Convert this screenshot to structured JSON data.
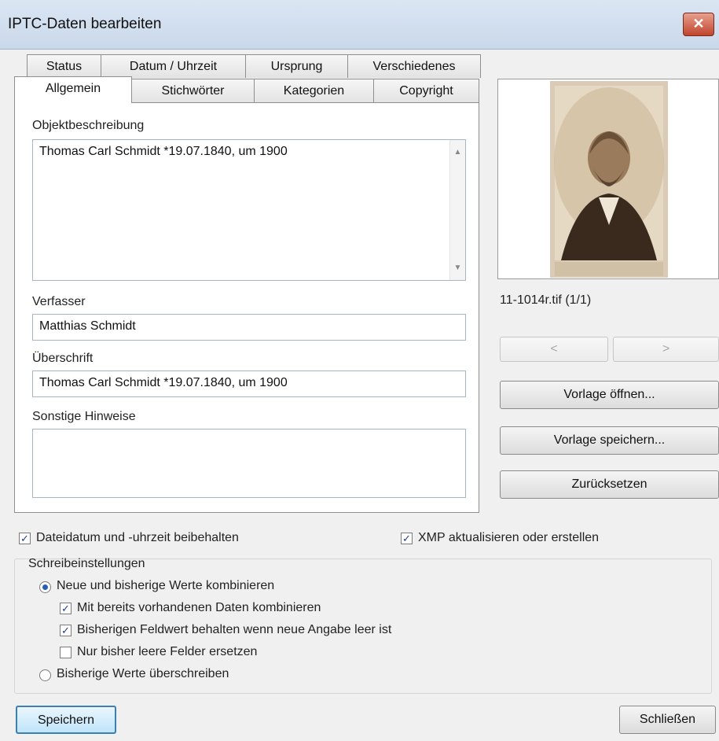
{
  "window": {
    "title": "IPTC-Daten bearbeiten",
    "close_glyph": "✕"
  },
  "tabs_row1": [
    "Status",
    "Datum / Uhrzeit",
    "Ursprung",
    "Verschiedenes"
  ],
  "tabs_row2": [
    "Allgemein",
    "Stichwörter",
    "Kategorien",
    "Copyright"
  ],
  "active_tab": "Allgemein",
  "fields": {
    "objektbeschreibung": {
      "label": "Objektbeschreibung",
      "value": "Thomas Carl Schmidt *19.07.1840, um 1900"
    },
    "verfasser": {
      "label": "Verfasser",
      "value": "Matthias Schmidt"
    },
    "ueberschrift": {
      "label": "Überschrift",
      "value": "Thomas Carl Schmidt *19.07.1840, um 1900"
    },
    "sonstige": {
      "label": "Sonstige Hinweise",
      "value": ""
    }
  },
  "preview": {
    "filename": "11-1014r.tif (1/1)"
  },
  "nav": {
    "prev": "<",
    "next": ">"
  },
  "buttons": {
    "vorlage_oeffnen": "Vorlage öffnen...",
    "vorlage_speichern": "Vorlage speichern...",
    "zuruecksetzen": "Zurücksetzen",
    "speichern": "Speichern",
    "schliessen": "Schließen"
  },
  "options": {
    "dateidatum": {
      "label": "Dateidatum und -uhrzeit beibehalten",
      "checked": true
    },
    "xmp": {
      "label": "XMP aktualisieren oder erstellen",
      "checked": true
    }
  },
  "schreib": {
    "title": "Schreibeinstellungen",
    "radio_kombinieren": {
      "label": "Neue und bisherige Werte kombinieren",
      "selected": true
    },
    "cb_vorhanden": {
      "label": "Mit bereits vorhandenen Daten kombinieren",
      "checked": true
    },
    "cb_behalten": {
      "label": "Bisherigen Feldwert behalten wenn neue Angabe leer ist",
      "checked": true
    },
    "cb_leer": {
      "label": "Nur bisher leere Felder ersetzen",
      "checked": false
    },
    "radio_ueberschreiben": {
      "label": "Bisherige Werte überschreiben",
      "selected": false
    }
  },
  "check_glyph": "✓",
  "colors": {
    "title_bar": "#c9d8ea",
    "close_button": "#c0442c",
    "check": "#1f3f8a",
    "radio_dot": "#2a5db8"
  }
}
